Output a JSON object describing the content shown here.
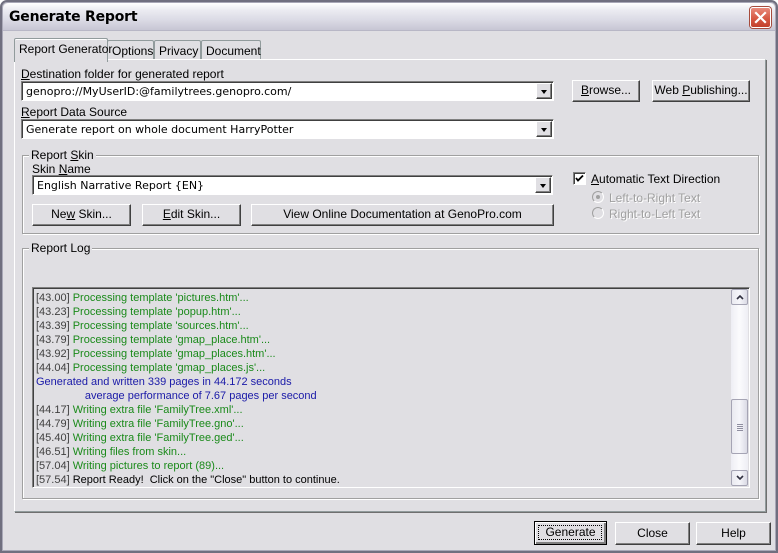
{
  "window": {
    "title": "Generate Report",
    "close_icon": "close-x-icon"
  },
  "tabs": [
    {
      "label": "Report Generator",
      "active": true
    },
    {
      "label": "Options",
      "active": false
    },
    {
      "label": "Privacy",
      "active": false
    },
    {
      "label": "Document",
      "active": false
    }
  ],
  "destination": {
    "label_u": "D",
    "label_rest": "estination folder for generated report",
    "value": "genopro://MyUserID:@familytrees.genopro.com/",
    "browse_u": "B",
    "browse_rest": "rowse...",
    "web_pre": "Web ",
    "web_u": "P",
    "web_rest": "ublishing..."
  },
  "data_source": {
    "label_u": "R",
    "label_rest": "eport Data Source",
    "value": "Generate report on whole document HarryPotter"
  },
  "skin": {
    "group_pre": "Report ",
    "group_u": "S",
    "group_rest": "kin",
    "name_pre": "Skin ",
    "name_u": "N",
    "name_rest": "ame",
    "value": "English Narrative Report  {EN}",
    "new_pre": "Ne",
    "new_u": "w",
    "new_rest": " Skin...",
    "edit_u": "E",
    "edit_rest": "dit Skin...",
    "docs_label": "View Online Documentation at GenoPro.com",
    "auto_dir_u": "A",
    "auto_dir_rest": "utomatic Text Direction",
    "auto_dir_checked": true,
    "ltr_label": "Left-to-Right Text",
    "ltr_selected": true,
    "rtl_label": "Right-to-Left Text",
    "rtl_selected": false
  },
  "log": {
    "group_label": "Report Log",
    "lines": [
      {
        "ts": "[43.00] ",
        "msg": "Processing template 'pictures.htm'...",
        "kind": "green"
      },
      {
        "ts": "[43.23] ",
        "msg": "Processing template 'popup.htm'...",
        "kind": "green"
      },
      {
        "ts": "[43.39] ",
        "msg": "Processing template 'sources.htm'...",
        "kind": "green"
      },
      {
        "ts": "[43.79] ",
        "msg": "Processing template 'gmap_place.htm'...",
        "kind": "green"
      },
      {
        "ts": "[43.92] ",
        "msg": "Processing template 'gmap_places.htm'...",
        "kind": "green"
      },
      {
        "ts": "[44.04] ",
        "msg": "Processing template 'gmap_places.js'...",
        "kind": "green"
      },
      {
        "ts": "",
        "msg": "Generated and written 339 pages in 44.172 seconds",
        "kind": "blue"
      },
      {
        "ts": "",
        "msg": "                average performance of 7.67 pages per second",
        "kind": "blue"
      },
      {
        "ts": "[44.17] ",
        "msg": "Writing extra file 'FamilyTree.xml'...",
        "kind": "green"
      },
      {
        "ts": "[44.79] ",
        "msg": "Writing extra file 'FamilyTree.gno'...",
        "kind": "green"
      },
      {
        "ts": "[45.40] ",
        "msg": "Writing extra file 'FamilyTree.ged'...",
        "kind": "green"
      },
      {
        "ts": "[46.51] ",
        "msg": "Writing files from skin...",
        "kind": "green"
      },
      {
        "ts": "[57.04] ",
        "msg": "Writing pictures to report (89)...",
        "kind": "green"
      },
      {
        "ts": "[57.54] ",
        "msg": "Report Ready!  Click on the \"Close\" button to continue.",
        "kind": "black"
      }
    ],
    "scroll_position": 0.85
  },
  "footer": {
    "generate_label": "Generate",
    "close_label": "Close",
    "help_label": "Help"
  },
  "colors": {
    "log_green": "#1a8a1a",
    "log_blue": "#1a1aa8",
    "dialog_bg": "#e0dfe3",
    "close_button": "#d4553f"
  }
}
